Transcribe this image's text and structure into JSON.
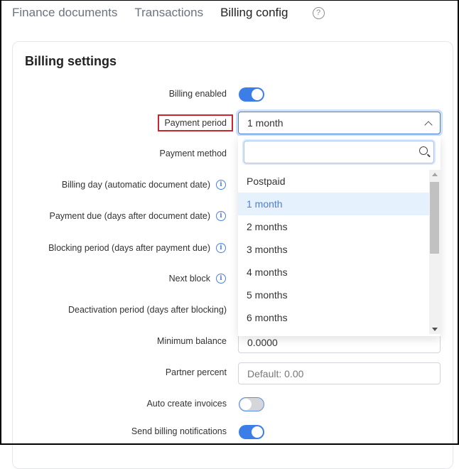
{
  "tabs": [
    {
      "label": "Finance documents",
      "active": false
    },
    {
      "label": "Transactions",
      "active": false
    },
    {
      "label": "Billing config",
      "active": true
    }
  ],
  "help_icon": "question-circle-icon",
  "card": {
    "title": "Billing settings",
    "fields": {
      "billing_enabled": {
        "label": "Billing enabled",
        "value": true
      },
      "payment_period": {
        "label": "Payment period",
        "value": "1 month",
        "highlighted": true
      },
      "payment_method": {
        "label": "Payment method"
      },
      "billing_day": {
        "label": "Billing day (automatic document date)",
        "icon": "info-icon"
      },
      "payment_due": {
        "label": "Payment due (days after document date)",
        "icon": "info-icon"
      },
      "blocking_period": {
        "label": "Blocking period (days after payment due)",
        "icon": "info-icon"
      },
      "next_block": {
        "label": "Next block",
        "icon": "info-icon"
      },
      "deactivation_period": {
        "label": "Deactivation period (days after blocking)"
      },
      "minimum_balance": {
        "label": "Minimum balance",
        "value": "0.0000"
      },
      "partner_percent": {
        "label": "Partner percent",
        "value": "",
        "placeholder": "Default: 0.00"
      },
      "auto_create_invoices": {
        "label": "Auto create invoices",
        "value": false
      },
      "send_billing_notifications": {
        "label": "Send billing notifications",
        "value": true
      }
    }
  },
  "dropdown": {
    "search_value": "",
    "options": [
      "Postpaid",
      "1 month",
      "2 months",
      "3 months",
      "4 months",
      "5 months",
      "6 months"
    ],
    "selected": "1 month"
  },
  "colors": {
    "accent": "#3b7ee8",
    "highlight_box": "#c8262c",
    "selected_bg": "#e6f1fe"
  }
}
